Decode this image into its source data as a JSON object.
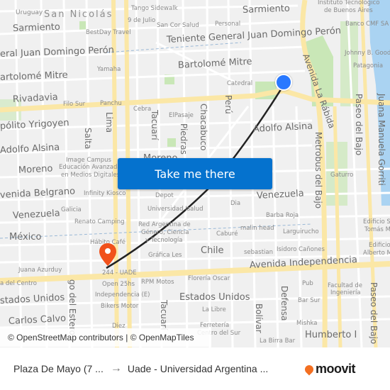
{
  "map": {
    "district": "San Nicolás",
    "streets": {
      "uruguay": "Uruguay",
      "sarmiento_w": "Sarmiento",
      "sarmiento_e": "Sarmiento",
      "peron_w": "eral Juan Domingo Perón",
      "peron_e": "Teniente General Juan Domingo Perón",
      "mitre_w": "artolomé Mitre",
      "mitre_e": "Bartolomé Mitre",
      "rivadavia": "Rivadavia",
      "yrigoyen": "pólito Yrigoyen",
      "alsina_w": "Adolfo Alsina",
      "alsina_e": "Adolfo Alsina",
      "moreno": "Moreno",
      "moreno2": "Moreno",
      "belgrano": "venida Belgrano",
      "venezuela_w": "Venezuela",
      "venezuela_e": "Venezuela",
      "mexico": "México",
      "chile": "Chile",
      "independencia": "Avenida Independencia",
      "del_centro": "a del Centro",
      "estados_unidos_w": "stados Unidos",
      "estados_unidos_e": "Estados Unidos",
      "carlos_calvo": "Carlos Calvo",
      "humberto": "Humberto I",
      "lima": "Lima",
      "salta": "Salta",
      "tacuari": "Tacuarí",
      "tacuari2": "Tacuarí",
      "piedras": "Piedras",
      "chacabuco": "Chacabuco",
      "peru": "Perú",
      "bolivar": "Bolívar",
      "defensa": "Defensa",
      "santiago_estero": "go del Estero",
      "la_rabida": "Avenida La Rábida",
      "metrobus": "Metrobus del Bajo",
      "paseo_bajo_1": "Paseo del Bajo",
      "paseo_bajo_2": "Paseo del Bajo",
      "gorriti": "Juana Manuela Gorriti"
    },
    "pois": {
      "tango": "Tango Sidewalk",
      "nueve_julio": "9 de Julio",
      "san_cor": "San Cor Salud",
      "personal": "Personal",
      "bestday": "BestDay Travel",
      "yamaha": "Yamaha",
      "catedral": "Catedral",
      "itba1": "Instituto Tecnológico",
      "itba2": "de Buenos Aires",
      "banco": "Banco CMF SA",
      "johnny": "Johnny B. Good",
      "patagonia": "Patagonia",
      "filo": "Filo Sur",
      "panchu": "Panchu",
      "cebra": "Cebra",
      "pasaje": "ElPasaje",
      "image1": "Image Campus",
      "image2": "Educación Avanzada",
      "image3": "en Medios Digitales",
      "infinity": "Infinity Kiosco",
      "depot": "Depot",
      "gaturro": "Gaturro",
      "dia": "Dia",
      "univ_salud": "Universidad Isalud",
      "galicia": "Galicia",
      "renato": "Renato Camping",
      "barba": "Barba Roja",
      "red1": "Red Argentina de",
      "red2": "Género, Ciencia",
      "red3": "y Tecnología",
      "malin": "malin head",
      "cabure": "Caburé",
      "larguirucho": "Larguirucho",
      "habito": "Hábito Café",
      "grafica": "Gráfica Les",
      "sebastian": "sebastian",
      "isidoro": "Isidoro Cañones",
      "edif1a": "Edificio S",
      "edif1b": "Tomás M",
      "edif2a": "Edificio",
      "edif2b": "Alberto M",
      "juana": "Juana Azurduy",
      "uade": "244 - UADE",
      "open25": "Open 25hs",
      "rpm": "RPM Motos",
      "floreria": "Florería Oscar",
      "pub": "Pub",
      "facultad1": "Facultad de",
      "facultad2": "Ingeniería",
      "indep_e": "Independencia (E)",
      "bikers": "Bikers Motor",
      "bar_sur": "Bar Sur",
      "la_libre": "La Libre",
      "ferreteria": "Ferretería",
      "centro_sur": "Centro del Sur",
      "mishka": "Mishka",
      "diez": "Diez",
      "birra": "La Birra Bar"
    },
    "attribution": "© OpenStreetMap contributors | © OpenMapTiles",
    "cta_label": "Take me there",
    "colors": {
      "cta": "#0572ce",
      "origin": "#2979ff",
      "destination": "#f1511b",
      "route": "#222222",
      "water": "#aad3f2",
      "park": "#c9e7b7",
      "major_road": "#fbe7a6",
      "brand": "#f36f21"
    }
  },
  "footer": {
    "from": "Plaza De Mayo (7 ...",
    "arrow": "→",
    "to": "Uade - Universidad Argentina ...",
    "brand": "moovit"
  }
}
